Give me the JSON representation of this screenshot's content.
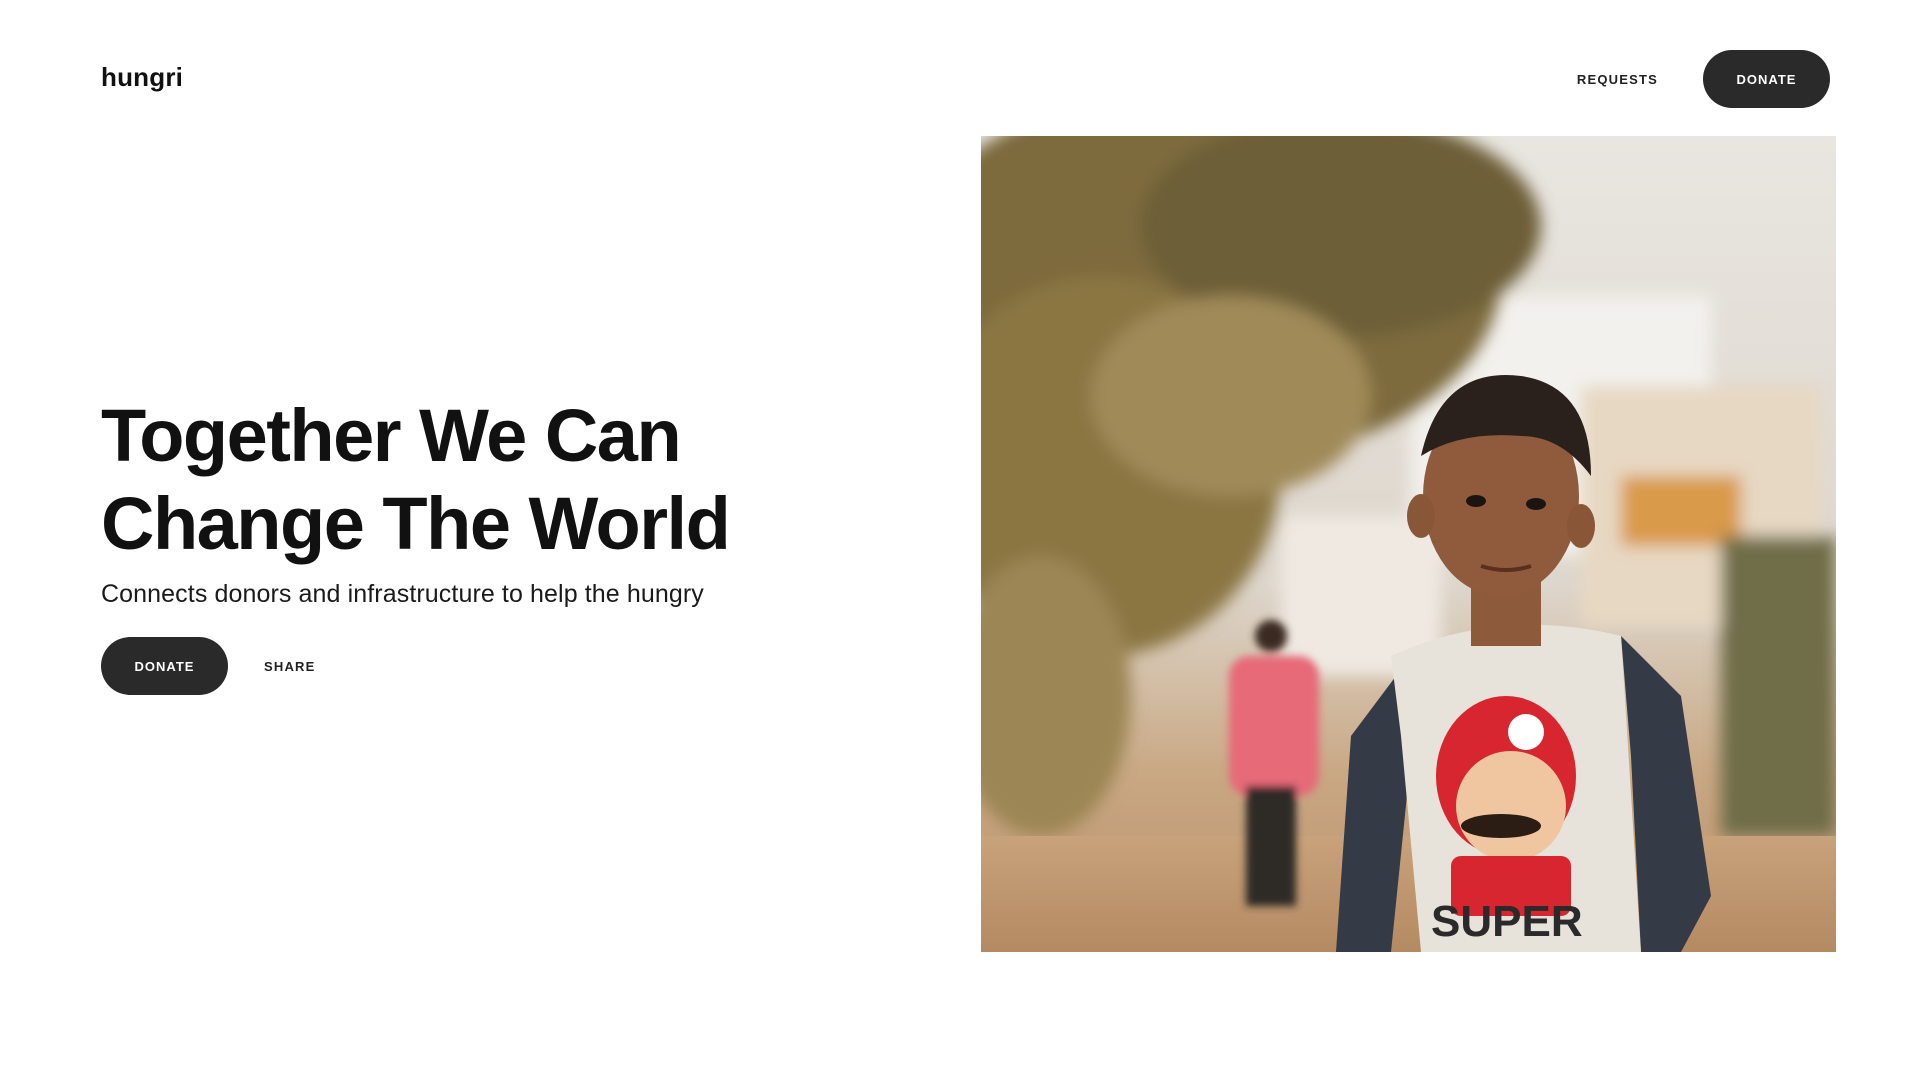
{
  "header": {
    "logo": "hungri",
    "nav_requests": "REQUESTS",
    "nav_donate": "DONATE"
  },
  "hero": {
    "headline_line1": "Together We Can",
    "headline_line2": "Change The World",
    "subtitle": "Connects donors and infrastructure to help the hungry",
    "donate_label": "DONATE",
    "share_label": "SHARE"
  },
  "image": {
    "shirt_text": "SUPER"
  },
  "colors": {
    "button_bg": "#2a2a2a",
    "button_text": "#ffffff",
    "text": "#111111",
    "background": "#ffffff"
  }
}
